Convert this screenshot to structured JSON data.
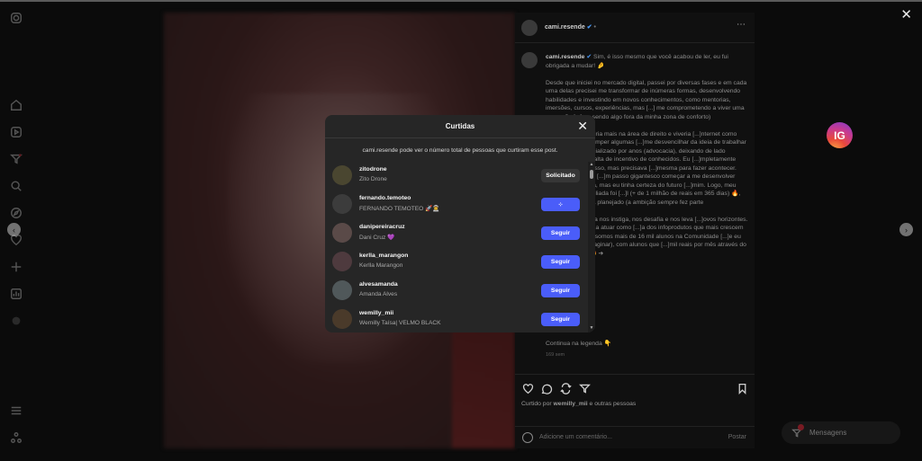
{
  "sidebar": {
    "icons": [
      "instagram-icon",
      "home-icon",
      "reels-icon",
      "notifications-icon",
      "search-icon",
      "explore-icon",
      "activity-icon",
      "create-icon",
      "profile-icon",
      "more-icon",
      "threads-icon",
      "menu-icon",
      "meta-icon"
    ]
  },
  "post": {
    "author": "cami.resende",
    "header_suffix": "•",
    "caption_author": "cami.resende",
    "caption": "Sim, é isso mesmo que você acabou de ler, eu fui obrigada a mudar! 🤌\n\nDesde que iniciei no mercado digital, passei por diversas fases e em cada uma delas precisei me transformar de inúmeras formas, desenvolvendo habilidades e investindo em novos conhecimentos, como mentorias, imersões, cursos, experiências, mas [...] me comprometendo a viver uma ascensão [...]mo sendo algo fora da minha zona de conforto)\n\n[...]i que não seguiria mais na área de direito e viveria [...]nternet como afiliada, preciso romper algumas [...]me desvencilhar da ideia de trabalhar com algo que [...]cializado por anos (advocacia), deixando de lado [...]negativos e a falta de incentivo de conhecidos. Eu [...]mpletamente sozinha e sabia disso, mas precisava [...]mesma para fazer acontecer. Apesar de ter sido [...]m passo gigantesco começar a me desenvolver [...]letamente nova, mas eu tinha certeza do futuro [...]mim. Logo, meu resultado como afiliada foi [...]l (+ de 1 milhão de reais em 365 dias) 🔥, mas [...]e eu havia planejado (a ambição sempre fez parte\n\n[...]dança é que ela nos instiga, nos desafia e nos leva [...]ovos horizontes. De afiliada passei a atuar como [...]a dos infoprodutos que mais crescem no Mercado [...]e, somos mais de 16 mil alunos na Comunidade [...]e eu jamais poderia imaginar), com alunos que [...]mil reais por mês através do que ensinamos 😍 ➜",
    "more_link": "Continua na legenda 👇",
    "time": "169 sem",
    "liked_by_prefix": "Curtido por ",
    "liked_by_user": "wemilly_mii",
    "liked_by_suffix": " e outras pessoas",
    "comment_placeholder": "Adicione um comentário...",
    "post_button": "Postar"
  },
  "badge": {
    "label": "IG"
  },
  "messages": {
    "label": "Mensagens"
  },
  "modal": {
    "title": "Curtidas",
    "note": "cami.resende pode ver o número total de pessoas que curtiram esse post.",
    "rows": [
      {
        "username": "zitodrone",
        "name": "Zito Drone",
        "button": "Solicitado",
        "state": "requested",
        "avatar_color": "#4a4630"
      },
      {
        "username": "fernando.temoteo",
        "name": "FERNANDO TEMOTEO 🚀👨‍🚀",
        "button": "⁘",
        "state": "loading",
        "avatar_color": "#3c3c3c"
      },
      {
        "username": "danipereiracruz",
        "name": "Dani Cruz 💜",
        "button": "Seguir",
        "state": "follow",
        "avatar_color": "#5a4a48"
      },
      {
        "username": "kerlla_marangon",
        "name": "Kerlla Marangon",
        "button": "Seguir",
        "state": "follow",
        "avatar_color": "#4e3a3e"
      },
      {
        "username": "alvesamanda",
        "name": "Amanda Alves",
        "button": "Seguir",
        "state": "follow",
        "avatar_color": "#50585a"
      },
      {
        "username": "wemilly_mii",
        "name": "Wemilly Taísa| VELMO BLACK",
        "button": "Seguir",
        "state": "follow",
        "avatar_color": "#4a3a2a"
      }
    ]
  },
  "colors": {
    "accent": "#4a5df9",
    "modal_bg": "#262626",
    "requested_bg": "#363636"
  }
}
